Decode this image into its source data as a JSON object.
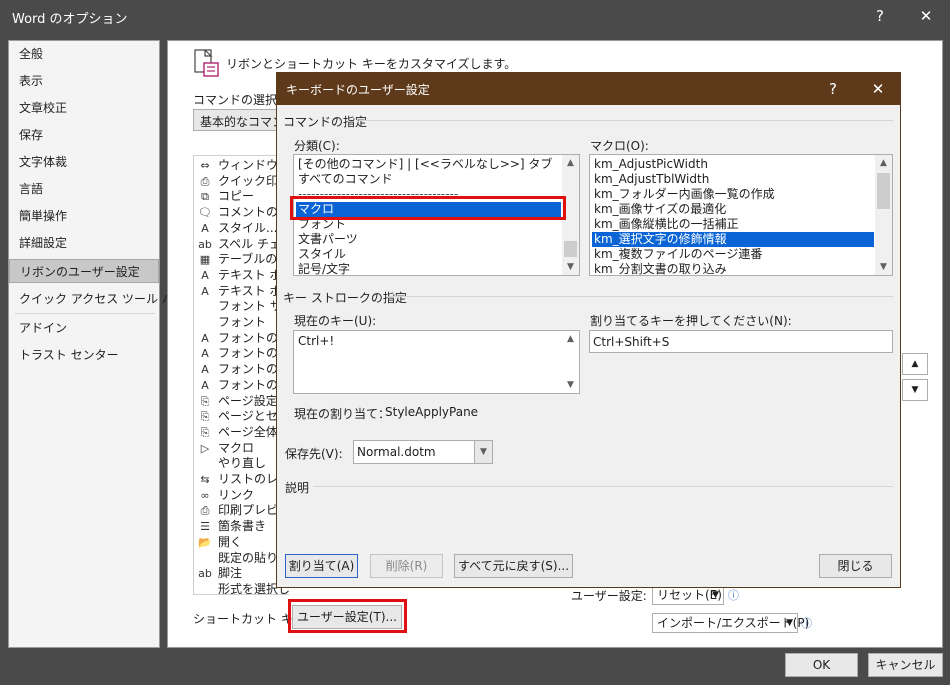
{
  "window": {
    "title": "Word のオプション",
    "help_label": "?",
    "close_label": "✕"
  },
  "nav": {
    "items": [
      "全般",
      "表示",
      "文章校正",
      "保存",
      "文字体裁",
      "言語",
      "簡単操作",
      "詳細設定",
      "リボンのユーザー設定",
      "クイック アクセス ツール バー",
      "アドイン",
      "トラスト センター"
    ],
    "selected": "リボンのユーザー設定"
  },
  "ribbon_panel": {
    "heading": "リボンとショートカット キーをカスタマイズします。",
    "choose_commands_label": "コマンドの選択(C",
    "choose_commands_value": "基本的なコマンド",
    "commands": [
      {
        "icon": "⇔",
        "label": "ウィンドウ幅に"
      },
      {
        "icon": "⎙",
        "label": "クイック印刷"
      },
      {
        "icon": "⧉",
        "label": "コピー"
      },
      {
        "icon": "🗨",
        "label": "コメントの挿入"
      },
      {
        "icon": "A",
        "label": "スタイル..."
      },
      {
        "icon": "ab",
        "label": "スペル チェック"
      },
      {
        "icon": "▦",
        "label": "テーブルの追加"
      },
      {
        "icon": "A",
        "label": "テキスト ボックス"
      },
      {
        "icon": "A",
        "label": "テキスト ボックス"
      },
      {
        "icon": "",
        "label": "フォント サイズ"
      },
      {
        "icon": "",
        "label": "フォント"
      },
      {
        "icon": "A",
        "label": "フォントの拡大"
      },
      {
        "icon": "A",
        "label": "フォントの縮小"
      },
      {
        "icon": "A",
        "label": "フォントの色"
      },
      {
        "icon": "A",
        "label": "フォントの設定"
      },
      {
        "icon": "⎘",
        "label": "ページ設定..."
      },
      {
        "icon": "⎘",
        "label": "ページとセクション"
      },
      {
        "icon": "⎘",
        "label": "ページ全体を"
      },
      {
        "icon": "▷",
        "label": "マクロ"
      },
      {
        "icon": "",
        "label": "やり直し"
      },
      {
        "icon": "⇆",
        "label": "リストのレベル"
      },
      {
        "icon": "∞",
        "label": "リンク"
      },
      {
        "icon": "⎙",
        "label": "印刷プレビュー"
      },
      {
        "icon": "☰",
        "label": "箇条書き"
      },
      {
        "icon": "📂",
        "label": "開く"
      },
      {
        "icon": "",
        "label": "既定の貼り付け"
      },
      {
        "icon": "ab",
        "label": "脚注"
      },
      {
        "icon": "",
        "label": "形式を選択して貼り付け"
      }
    ],
    "shortcut_label": "ショートカット キー:",
    "customize_button": "ユーザー設定(T)...",
    "user_settings_label": "ユーザー設定:",
    "reset_button": "リセット(E)",
    "import_export_button": "インポート/エクスポート(P)",
    "info_glyph": "ⓘ"
  },
  "dialog": {
    "title": "キーボードのユーザー設定",
    "help_label": "?",
    "close_label": "✕",
    "specify_command": "コマンドの指定",
    "categories_label": "分類(C):",
    "categories": [
      "[その他のコマンド] | [<<ラベルなし>>] タブ",
      "すべてのコマンド",
      "-------------------------------------",
      "マクロ",
      "フォント",
      "文書パーツ",
      "スタイル",
      "記号/文字"
    ],
    "categories_selected": "マクロ",
    "macros_label": "マクロ(O):",
    "macros": [
      "km_AdjustPicWidth",
      "km_AdjustTblWidth",
      "km_フォルダー内画像一覧の作成",
      "km_画像サイズの最適化",
      "km_画像縦横比の一括補正",
      "km_選択文字の修飾情報",
      "km_複数ファイルのページ連番",
      "km_分割文書の取り込み"
    ],
    "macros_selected": "km_選択文字の修飾情報",
    "keystroke_section": "キー ストロークの指定",
    "current_keys_label": "現在のキー(U):",
    "current_keys": [
      "Ctrl+!"
    ],
    "press_new_key_label": "割り当てるキーを押してください(N):",
    "press_new_key_value": "Ctrl+Shift+S",
    "currently_assigned_label": "現在の割り当て：",
    "currently_assigned_value": "StyleApplyPane",
    "save_in_label": "保存先(V):",
    "save_in_value": "Normal.dotm",
    "description_label": "説明",
    "assign_button": "割り当て(A)",
    "remove_button": "削除(R)",
    "reset_all_button": "すべて元に戻す(S)...",
    "close_button": "閉じる"
  },
  "footer": {
    "ok_button": "OK",
    "cancel_button": "キャンセル"
  },
  "colors": {
    "accent": "#0a64d6",
    "dialog_title": "#5e3a1a",
    "highlight": "#e01010"
  }
}
